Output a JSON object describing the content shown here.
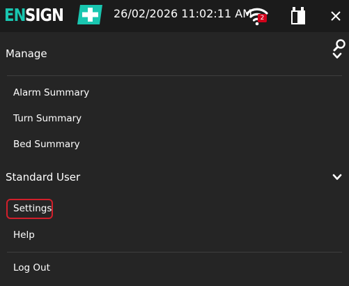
{
  "header": {
    "logo_text_accent": "EN",
    "logo_text_main": "SIGN",
    "datetime": "26/02/2026 11:02:11 AM",
    "wifi_badge_count": "2",
    "icons": [
      "wifi-icon",
      "battery-icon",
      "close-icon",
      "plus-icon"
    ]
  },
  "colors": {
    "accent": "#19c6b0",
    "background": "#252525",
    "topbar": "#1b1b1b",
    "highlight": "#d21f2b",
    "badge": "#d0021b"
  },
  "manage": {
    "title": "Manage",
    "items": [
      {
        "label": "Alarm Summary"
      },
      {
        "label": "Turn Summary"
      },
      {
        "label": "Bed Summary"
      }
    ]
  },
  "user": {
    "title": "Standard User",
    "items": [
      {
        "label": "Settings"
      },
      {
        "label": "Help"
      },
      {
        "label": "Log Out"
      }
    ]
  }
}
